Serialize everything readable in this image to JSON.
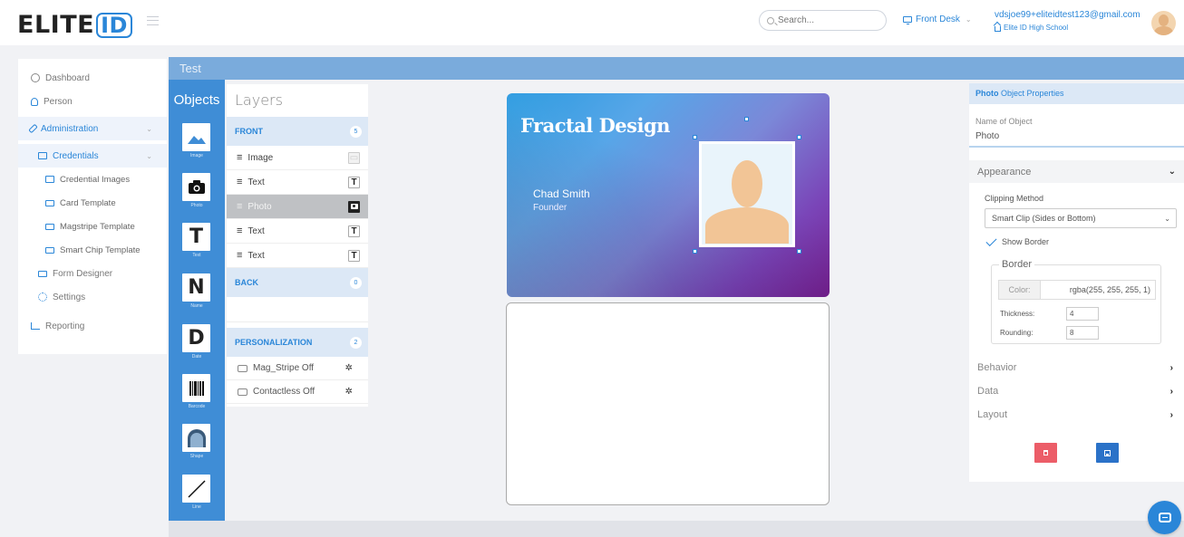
{
  "header": {
    "logo_text": "ELITE",
    "logo_id": "ID",
    "search_placeholder": "Search...",
    "location": "Front Desk",
    "user_email": "vdsjoe99+eliteidtest123@gmail.com",
    "user_school": "Elite ID High School"
  },
  "sidebar": {
    "dashboard": "Dashboard",
    "person": "Person",
    "administration": "Administration",
    "credentials": "Credentials",
    "credential_images": "Credential Images",
    "card_template": "Card Template",
    "magstripe_template": "Magstripe Template",
    "smart_chip_template": "Smart Chip Template",
    "form_designer": "Form Designer",
    "settings": "Settings",
    "reporting": "Reporting"
  },
  "main": {
    "title": "Test"
  },
  "objects": {
    "title": "Objects",
    "items": [
      {
        "label": "Image"
      },
      {
        "label": "Photo"
      },
      {
        "label": "Text",
        "glyph": "T"
      },
      {
        "label": "Name",
        "glyph": "N"
      },
      {
        "label": "Date",
        "glyph": "D"
      },
      {
        "label": "Barcode"
      },
      {
        "label": "Shape"
      },
      {
        "label": "Line"
      }
    ]
  },
  "layers": {
    "title": "Layers",
    "front": {
      "label": "FRONT",
      "count": "5"
    },
    "front_rows": [
      {
        "label": "Image"
      },
      {
        "label": "Text",
        "tag": "T"
      },
      {
        "label": "Photo"
      },
      {
        "label": "Text",
        "tag": "T"
      },
      {
        "label": "Text",
        "tag": "T"
      }
    ],
    "back": {
      "label": "BACK",
      "count": "0"
    },
    "personalization": {
      "label": "PERSONALIZATION",
      "count": "2"
    },
    "pers_rows": [
      {
        "label": "Mag_Stripe Off"
      },
      {
        "label": "Contactless Off"
      }
    ]
  },
  "card": {
    "title": "Fractal Design",
    "name": "Chad Smith",
    "role": "Founder"
  },
  "properties": {
    "header_bold": "Photo",
    "header_rest": "Object Properties",
    "name_label": "Name of Object",
    "name_value": "Photo",
    "appearance": "Appearance",
    "clipping_label": "Clipping Method",
    "clipping_value": "Smart Clip (Sides or Bottom)",
    "show_border": "Show Border",
    "border_legend": "Border",
    "color_label": "Color:",
    "color_value": "rgba(255, 255, 255, 1)",
    "thickness_label": "Thickness:",
    "thickness_value": "4",
    "rounding_label": "Rounding:",
    "rounding_value": "8",
    "behavior": "Behavior",
    "data": "Data",
    "layout": "Layout"
  },
  "colors": {
    "accent": "#2a86d8",
    "objects_panel": "#3f8dd6",
    "delete": "#ec5d68",
    "save": "#2b72c8"
  }
}
